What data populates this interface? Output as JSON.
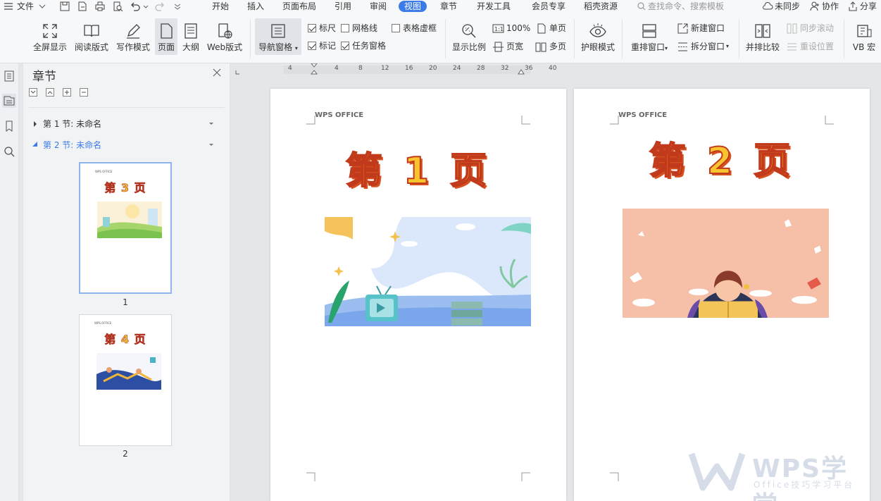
{
  "menubar": {
    "file_label": "文件",
    "tabs": [
      "开始",
      "插入",
      "页面布局",
      "引用",
      "审阅",
      "视图",
      "章节",
      "开发工具",
      "会员专享",
      "稻壳资源"
    ],
    "active_tab": "视图",
    "search_placeholder": "查找命令、搜索模板",
    "sync_label": "未同步",
    "collab_label": "协作",
    "share_label": "分享"
  },
  "ribbon": {
    "fullscreen": "全屏显示",
    "reading": "阅读版式",
    "writing": "写作模式",
    "page": "页面",
    "outline": "大纲",
    "web": "Web版式",
    "nav_pane": "导航窗格",
    "chk_ruler": "标尺",
    "chk_grid": "网格线",
    "chk_table": "表格虚框",
    "chk_mark": "标记",
    "chk_task": "任务窗格",
    "zoom": "显示比例",
    "zoom100": "100%",
    "pagewidth": "页宽",
    "single": "单页",
    "multi": "多页",
    "eye": "护眼模式",
    "rearrange": "重排窗口",
    "newwin": "新建窗口",
    "split": "拆分窗口",
    "compare": "并排比较",
    "syncscroll": "同步滚动",
    "resetpos": "重设位置",
    "vb": "VB 宏"
  },
  "navpane": {
    "title": "章节",
    "sections": [
      "第 1 节: 未命名",
      "第 2 节: 未命名"
    ],
    "thumbs": [
      {
        "logo": "WPS OFFICE",
        "title": "第 3 页",
        "num": "1"
      },
      {
        "logo": "WPS OFFICE",
        "title": "第 4 页",
        "num": "2"
      }
    ]
  },
  "ruler": {
    "ticks": [
      "4",
      "4",
      "8",
      "12",
      "16",
      "20",
      "24",
      "28",
      "32",
      "36",
      "40"
    ]
  },
  "pages": [
    {
      "header": "WPS OFFICE",
      "title": "第 1 页"
    },
    {
      "header": "WPS OFFICE",
      "title": "第 2 页"
    }
  ],
  "watermark": {
    "brand": "WPS学堂",
    "tagline": "Office技巧学习平台"
  },
  "colors": {
    "accent": "#3b7be8",
    "title_fill": "#f7c32f",
    "title_stroke": "#c23a1c"
  }
}
